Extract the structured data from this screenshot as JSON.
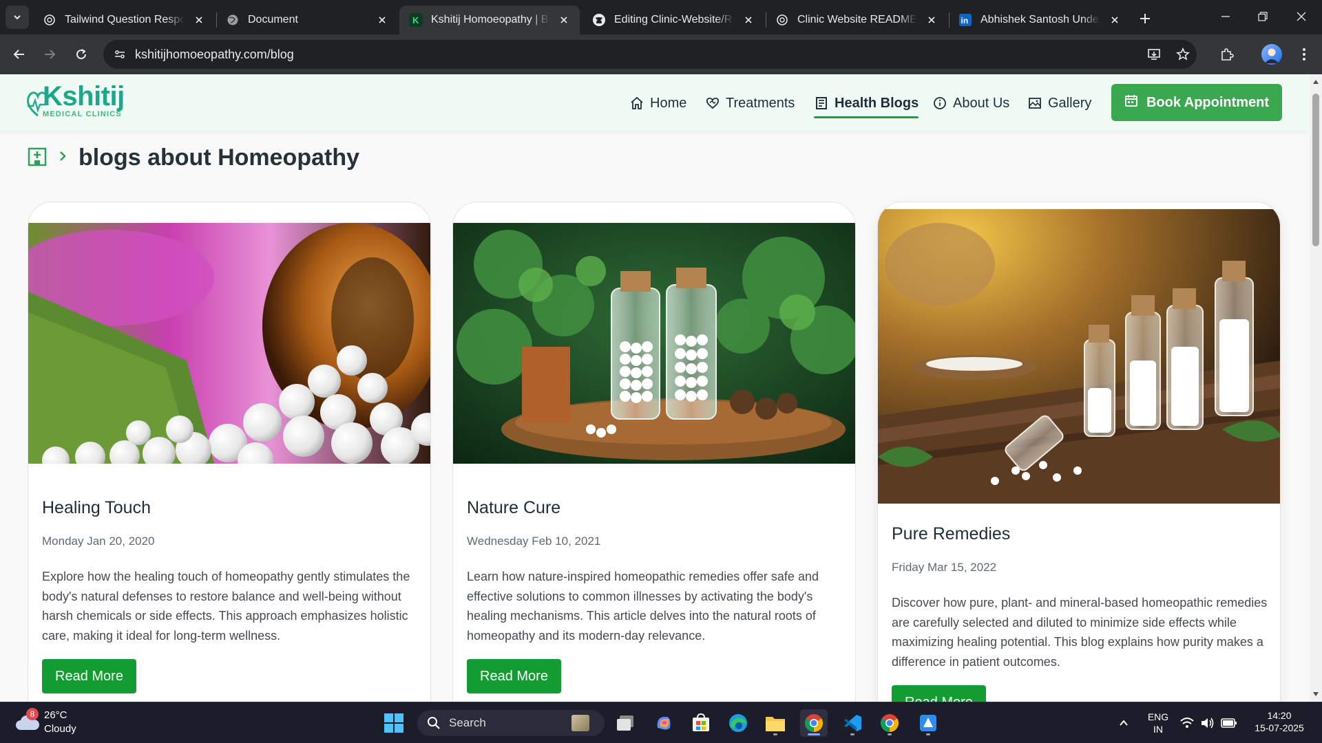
{
  "browser": {
    "tabs": [
      {
        "title": "Tailwind Question Respons",
        "icon": "openai-icon",
        "active": false
      },
      {
        "title": "Document",
        "icon": "globe-icon",
        "active": false
      },
      {
        "title": "Kshitij Homoeopathy | Best",
        "icon": "k-favicon-icon",
        "active": true
      },
      {
        "title": "Editing Clinic-Website/REA",
        "icon": "github-icon",
        "active": false
      },
      {
        "title": "Clinic Website README Gu",
        "icon": "openai-icon",
        "active": false
      },
      {
        "title": "Abhishek Santosh Unde | L",
        "icon": "linkedin-icon",
        "active": false
      }
    ],
    "url": "kshitijhomoeopathy.com/blog"
  },
  "site": {
    "logo_text": "Kshitij",
    "logo_subtext": "MEDICAL CLINICS",
    "nav": [
      {
        "label": "Home",
        "icon": "home-icon",
        "active": false
      },
      {
        "label": "Treatments",
        "icon": "heart-handshake-icon",
        "active": false
      },
      {
        "label": "Health Blogs",
        "icon": "blog-icon",
        "active": true
      },
      {
        "label": "About Us",
        "icon": "info-icon",
        "active": false
      },
      {
        "label": "Gallery",
        "icon": "image-icon",
        "active": false
      }
    ],
    "book_label": "Book Appointment",
    "breadcrumb_title": "blogs about Homeopathy",
    "accent_color": "#129c32"
  },
  "posts": [
    {
      "title": "Healing Touch",
      "date": "Monday Jan 20, 2020",
      "description": "Explore how the healing touch of homeopathy gently stimulates the body's natural defenses to restore balance and well-being without harsh chemicals or side effects. This approach emphasizes holistic care, making it ideal for long-term wellness.",
      "button": "Read More"
    },
    {
      "title": "Nature Cure",
      "date": "Wednesday Feb 10, 2021",
      "description": "Learn how nature-inspired homeopathic remedies offer safe and effective solutions to common illnesses by activating the body's healing mechanisms. This article delves into the natural roots of homeopathy and its modern-day relevance.",
      "button": "Read More"
    },
    {
      "title": "Pure Remedies",
      "date": "Friday Mar 15, 2022",
      "description": "Discover how pure, plant- and mineral-based homeopathic remedies are carefully selected and diluted to minimize side effects while maximizing healing potential. This blog explains how purity makes a difference in patient outcomes.",
      "button": "Read More"
    }
  ],
  "taskbar": {
    "weather_temp": "26°C",
    "weather_cond": "Cloudy",
    "weather_badge": "8",
    "search_label": "Search",
    "lang_top": "ENG",
    "lang_bottom": "IN",
    "time": "14:20",
    "date": "15-07-2025"
  }
}
